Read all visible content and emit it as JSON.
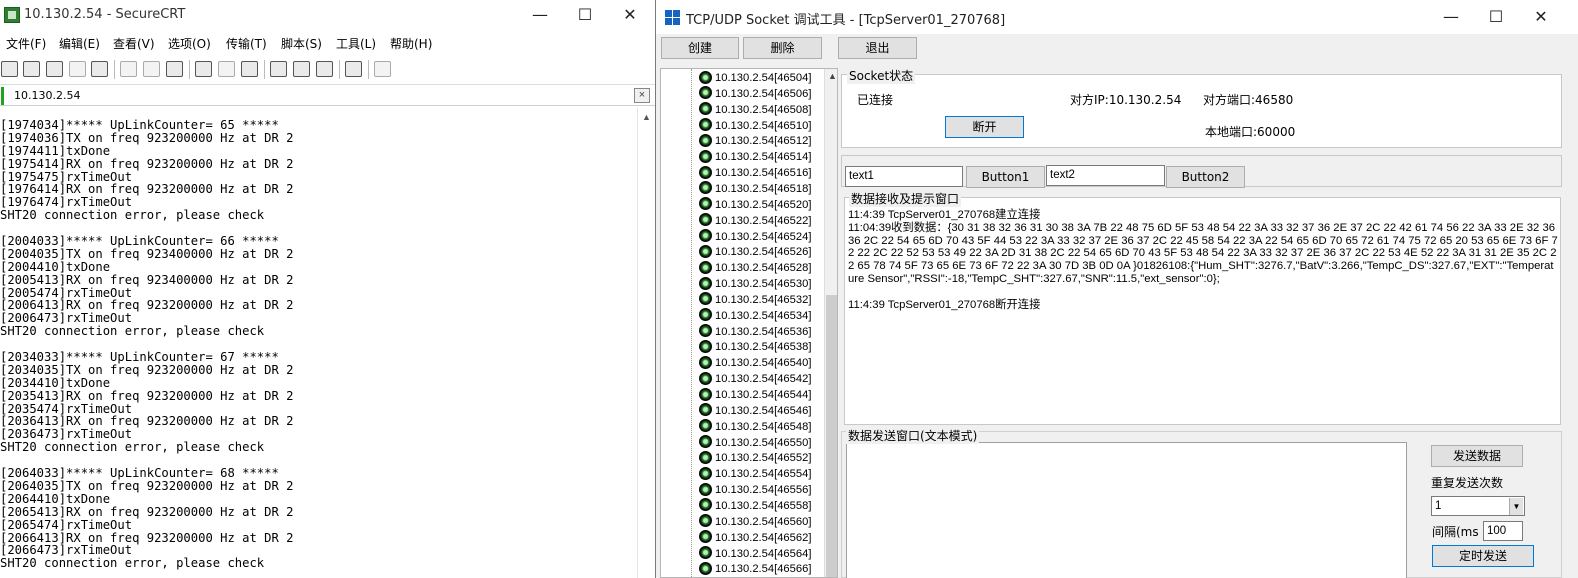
{
  "crt": {
    "title": "10.130.2.54 - SecureCRT",
    "menu": [
      "文件(F)",
      "编辑(E)",
      "查看(V)",
      "选项(O)",
      "传输(T)",
      "脚本(S)",
      "工具(L)",
      "帮助(H)"
    ],
    "tab_label": "10.130.2.54",
    "tab_close": "×",
    "window_buttons": {
      "minimize": "—",
      "maximize": "☐",
      "close": "✕"
    },
    "terminal_lines": [
      "[1974034]***** UpLinkCounter= 65 *****",
      "[1974036]TX on freq 923200000 Hz at DR 2",
      "[1974411]txDone",
      "[1975414]RX on freq 923200000 Hz at DR 2",
      "[1975475]rxTimeOut",
      "[1976414]RX on freq 923200000 Hz at DR 2",
      "[1976474]rxTimeOut",
      "SHT20 connection error, please check",
      "",
      "[2004033]***** UpLinkCounter= 66 *****",
      "[2004035]TX on freq 923400000 Hz at DR 2",
      "[2004410]txDone",
      "[2005413]RX on freq 923400000 Hz at DR 2",
      "[2005474]rxTimeOut",
      "[2006413]RX on freq 923200000 Hz at DR 2",
      "[2006473]rxTimeOut",
      "SHT20 connection error, please check",
      "",
      "[2034033]***** UpLinkCounter= 67 *****",
      "[2034035]TX on freq 923200000 Hz at DR 2",
      "[2034410]txDone",
      "[2035413]RX on freq 923200000 Hz at DR 2",
      "[2035474]rxTimeOut",
      "[2036413]RX on freq 923200000 Hz at DR 2",
      "[2036473]rxTimeOut",
      "SHT20 connection error, please check",
      "",
      "[2064033]***** UpLinkCounter= 68 *****",
      "[2064035]TX on freq 923200000 Hz at DR 2",
      "[2064410]txDone",
      "[2065413]RX on freq 923200000 Hz at DR 2",
      "[2065474]rxTimeOut",
      "[2066413]RX on freq 923200000 Hz at DR 2",
      "[2066473]rxTimeOut",
      "SHT20 connection error, please check"
    ]
  },
  "sock": {
    "title": "TCP/UDP Socket 调试工具 - [TcpServer01_270768]",
    "window_buttons": {
      "minimize": "—",
      "maximize": "☐",
      "close": "✕"
    },
    "toolbar": {
      "create": "创建",
      "delete": "删除",
      "exit": "退出"
    },
    "tree_items": [
      "10.130.2.54[46504]",
      "10.130.2.54[46506]",
      "10.130.2.54[46508]",
      "10.130.2.54[46510]",
      "10.130.2.54[46512]",
      "10.130.2.54[46514]",
      "10.130.2.54[46516]",
      "10.130.2.54[46518]",
      "10.130.2.54[46520]",
      "10.130.2.54[46522]",
      "10.130.2.54[46524]",
      "10.130.2.54[46526]",
      "10.130.2.54[46528]",
      "10.130.2.54[46530]",
      "10.130.2.54[46532]",
      "10.130.2.54[46534]",
      "10.130.2.54[46536]",
      "10.130.2.54[46538]",
      "10.130.2.54[46540]",
      "10.130.2.54[46542]",
      "10.130.2.54[46544]",
      "10.130.2.54[46546]",
      "10.130.2.54[46548]",
      "10.130.2.54[46550]",
      "10.130.2.54[46552]",
      "10.130.2.54[46554]",
      "10.130.2.54[46556]",
      "10.130.2.54[46558]",
      "10.130.2.54[46560]",
      "10.130.2.54[46562]",
      "10.130.2.54[46564]",
      "10.130.2.54[46566]"
    ],
    "status": {
      "legend": "Socket状态",
      "state": "已连接",
      "peer_ip": "对方IP:10.130.2.54",
      "peer_port": "对方端口:46580",
      "local_port": "本地端口:60000",
      "disconnect": "断开"
    },
    "custom": {
      "text1": "text1",
      "button1": "Button1",
      "text2": "text2",
      "button2": "Button2"
    },
    "receive": {
      "legend": "数据接收及提示窗口",
      "lines": [
        "11:4:39 TcpServer01_270768建立连接",
        "11:04:39收到数据：{30 31 38 32 36 31 30 38 3A 7B 22 48 75 6D 5F 53 48 54 22 3A 33 32 37 36 2E 37 2C 22 42 61 74 56 22 3A 33 2E 32 36 36 2C 22 54 65 6D 70 43 5F 44 53 22 3A 33 32 37 2E 36 37 2C 22 45 58 54 22 3A 22 54 65 6D 70 65 72 61 74 75 72 65 20 53 65 6E 73 6F 72 22 2C 22 52 53 53 49 22 3A 2D 31 38 2C 22 54 65 6D 70 43 5F 53 48 54 22 3A 33 32 37 2E 36 37 2C 22 53 4E 52 22 3A 31 31 2E 35 2C 22 65 78 74 5F 73 65 6E 73 6F 72 22 3A 30 7D 3B 0D 0A }01826108:{\"Hum_SHT\":3276.7,\"BatV\":3.266,\"TempC_DS\":327.67,\"EXT\":\"Temperature Sensor\",\"RSSI\":-18,\"TempC_SHT\":327.67,\"SNR\":11.5,\"ext_sensor\":0};",
        "",
        "11:4:39 TcpServer01_270768断开连接"
      ]
    },
    "send": {
      "legend": "数据发送窗口(文本模式)",
      "send_button": "发送数据",
      "repeat_label": "重复发送次数",
      "repeat_value": "1",
      "interval_label": "间隔(ms",
      "interval_value": "100",
      "timer_button": "定时发送"
    }
  }
}
